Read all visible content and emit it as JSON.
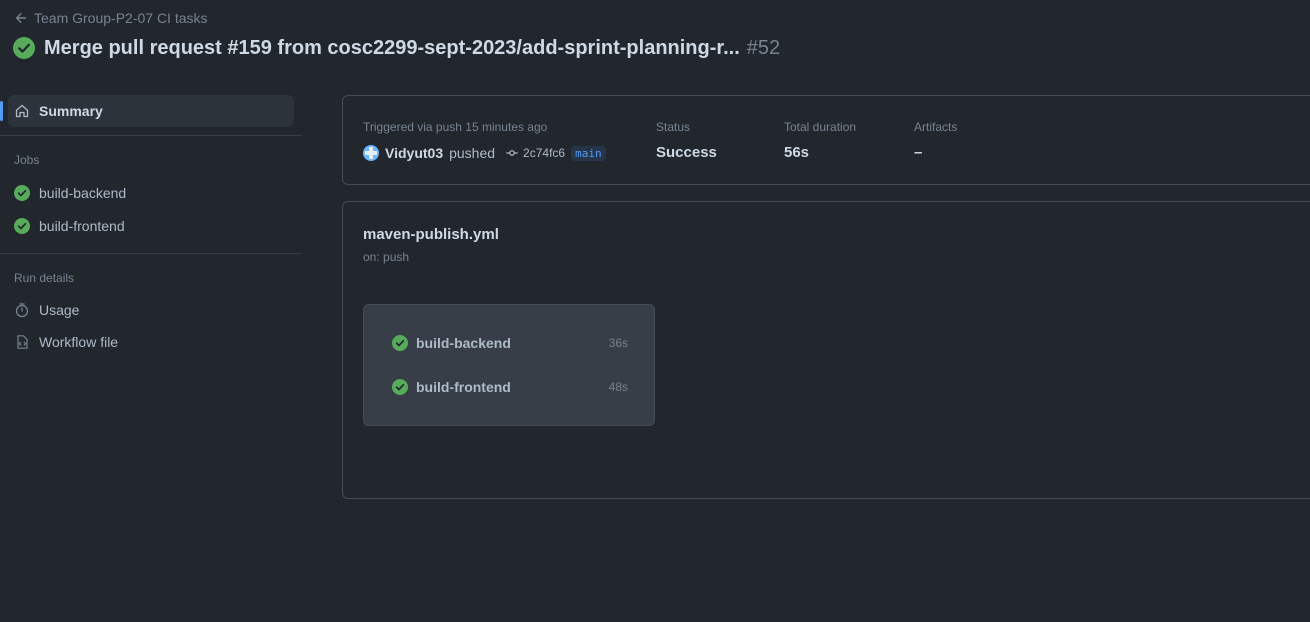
{
  "header": {
    "back_label": "Team Group-P2-07 CI tasks",
    "title": "Merge pull request #159 from cosc2299-sept-2023/add-sprint-planning-r...",
    "run_number": "#52"
  },
  "sidebar": {
    "summary_label": "Summary",
    "jobs_heading": "Jobs",
    "jobs": [
      {
        "label": "build-backend"
      },
      {
        "label": "build-frontend"
      }
    ],
    "run_details_heading": "Run details",
    "usage_label": "Usage",
    "workflow_file_label": "Workflow file"
  },
  "summary": {
    "trigger_text": "Triggered via push 15 minutes ago",
    "actor": "Vidyut03",
    "action": "pushed",
    "commit": "2c74fc6",
    "branch": "main",
    "status_label": "Status",
    "status_value": "Success",
    "duration_label": "Total duration",
    "duration_value": "56s",
    "artifacts_label": "Artifacts",
    "artifacts_value": "–"
  },
  "workflow": {
    "file": "maven-publish.yml",
    "trigger": "on: push",
    "jobs": [
      {
        "name": "build-backend",
        "duration": "36s"
      },
      {
        "name": "build-frontend",
        "duration": "48s"
      }
    ]
  },
  "colors": {
    "background": "#22272e",
    "success": "#57ab5a",
    "accent": "#539bf5",
    "border": "#444c56"
  },
  "icons": [
    "arrow-left-icon",
    "check-circle-icon",
    "home-icon",
    "stopwatch-icon",
    "file-code-icon",
    "git-commit-icon"
  ]
}
